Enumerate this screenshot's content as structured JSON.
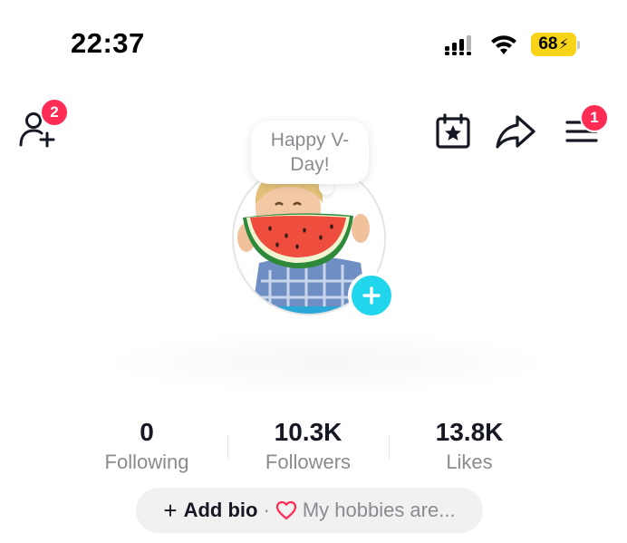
{
  "status_bar": {
    "time": "22:37",
    "battery": "68",
    "battery_color": "#f7d417"
  },
  "header": {
    "friends_badge": "2",
    "menu_badge": "1",
    "icons": [
      "add-friend-icon",
      "calendar-star-icon",
      "share-arrow-icon",
      "menu-icon"
    ],
    "badge_color": "#fe2c55"
  },
  "profile": {
    "note": "Happy V-Day!",
    "avatar_add_color": "#20d5ec"
  },
  "stats": [
    {
      "value": "0",
      "label": "Following"
    },
    {
      "value": "10.3K",
      "label": "Followers"
    },
    {
      "value": "13.8K",
      "label": "Likes"
    }
  ],
  "bio": {
    "plus": "+",
    "add_label": "Add bio",
    "separator": "·",
    "hint": "My hobbies are...",
    "heart_color": "#fe2c55"
  }
}
